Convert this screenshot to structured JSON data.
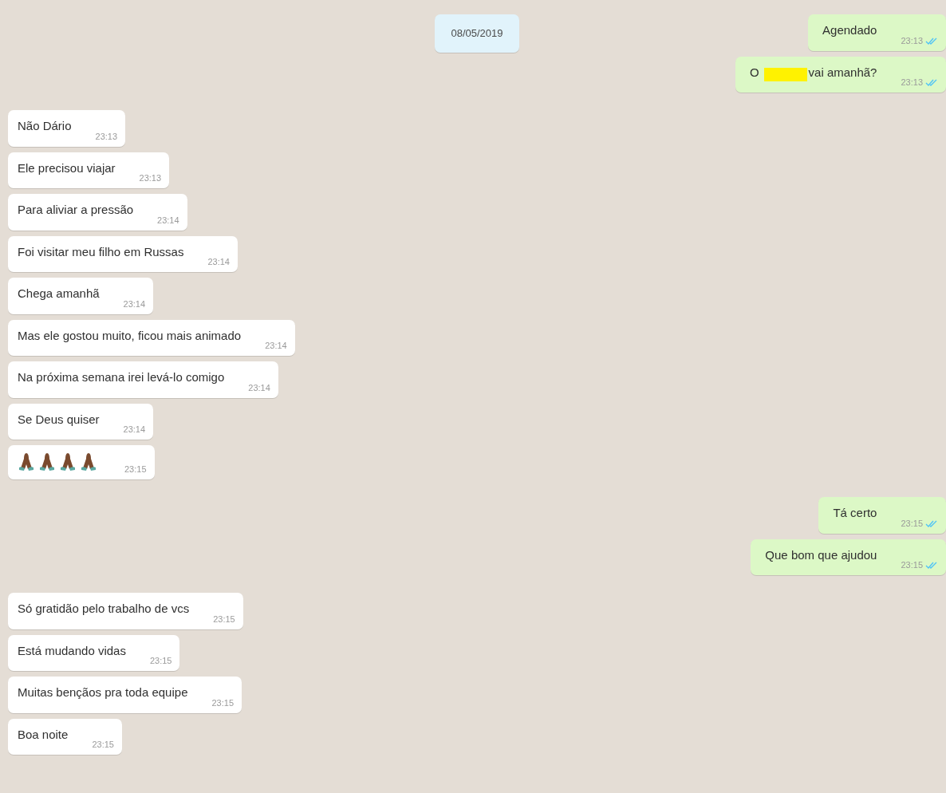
{
  "date_separator": "08/05/2019",
  "groups": [
    {
      "kind": "outgoing",
      "messages": [
        {
          "kind": "text",
          "text": "Agendado",
          "time": "23:13",
          "read": true
        },
        {
          "kind": "redacted",
          "before": "O",
          "after": "vai amanhã?",
          "time": "23:13",
          "read": true
        }
      ]
    },
    {
      "kind": "incoming",
      "messages": [
        {
          "kind": "text",
          "text": "Não Dário",
          "time": "23:13"
        },
        {
          "kind": "text",
          "text": "Ele precisou viajar",
          "time": "23:13"
        },
        {
          "kind": "text",
          "text": "Para aliviar a pressão",
          "time": "23:14"
        },
        {
          "kind": "text",
          "text": "Foi visitar meu filho em Russas",
          "time": "23:14"
        },
        {
          "kind": "text",
          "text": "Chega amanhã",
          "time": "23:14"
        },
        {
          "kind": "text",
          "text": "Mas ele gostou muito, ficou mais animado",
          "time": "23:14"
        },
        {
          "kind": "text",
          "text": "Na próxima semana irei levá-lo comigo",
          "time": "23:14"
        },
        {
          "kind": "text",
          "text": "Se Deus quiser",
          "time": "23:14"
        },
        {
          "kind": "emoji",
          "emojis": [
            {
              "kind": "folded-hands"
            },
            {
              "kind": "folded-hands"
            },
            {
              "kind": "folded-hands"
            },
            {
              "kind": "folded-hands"
            }
          ],
          "time": "23:15"
        }
      ]
    },
    {
      "kind": "outgoing",
      "messages": [
        {
          "kind": "text",
          "text": "Tá certo",
          "time": "23:15",
          "read": true
        },
        {
          "kind": "text",
          "text": "Que bom que ajudou",
          "time": "23:15",
          "read": true
        }
      ]
    },
    {
      "kind": "incoming",
      "messages": [
        {
          "kind": "text",
          "text": "Só gratidão pelo trabalho de vcs",
          "time": "23:15"
        },
        {
          "kind": "text",
          "text": "Está mudando vidas",
          "time": "23:15"
        },
        {
          "kind": "text",
          "text": "Muitas bençãos pra toda equipe",
          "time": "23:15"
        },
        {
          "kind": "text",
          "text": "Boa noite",
          "time": "23:15"
        }
      ]
    }
  ]
}
